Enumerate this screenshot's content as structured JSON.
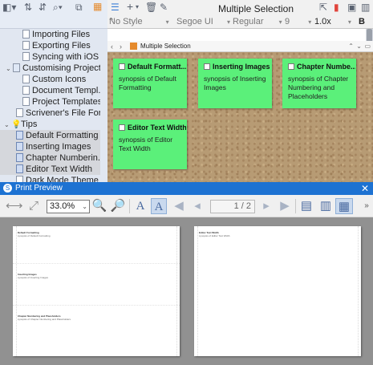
{
  "binder": {
    "items": [
      {
        "label": "Importing Files",
        "icon": "document-icon"
      },
      {
        "label": "Exporting Files",
        "icon": "document-icon"
      },
      {
        "label": "Syncing with iOS",
        "icon": "document-icon"
      },
      {
        "label": "Customising Projects",
        "icon": "folder-icon"
      },
      {
        "label": "Custom Icons",
        "icon": "document-icon"
      },
      {
        "label": "Document Templ...",
        "icon": "document-icon"
      },
      {
        "label": "Project Templates",
        "icon": "document-icon"
      },
      {
        "label": "Scrivener's File For...",
        "icon": "document-icon"
      },
      {
        "label": "Tips",
        "icon": "lightbulb-icon"
      },
      {
        "label": "Default Formatting",
        "icon": "document-icon"
      },
      {
        "label": "Inserting Images",
        "icon": "document-icon"
      },
      {
        "label": "Chapter Numberin...",
        "icon": "document-icon"
      },
      {
        "label": "Editor Text Width",
        "icon": "document-icon"
      },
      {
        "label": "Dark Mode Theme",
        "icon": "document-icon"
      }
    ]
  },
  "editor": {
    "title": "Multiple Selection",
    "style": "No Style",
    "font": "Segoe UI",
    "weight": "Regular",
    "size": "9",
    "zoom": "1.0x",
    "bold": "B",
    "breadcrumb": "Multiple Selection"
  },
  "cards": [
    {
      "title": "Default Formatt...",
      "synopsis": "synopsis of Default Formatting"
    },
    {
      "title": "Inserting Images",
      "synopsis": "synopsis of Inserting Images"
    },
    {
      "title": "Chapter Numbe...",
      "synopsis": "synopsis of Chapter Numbering and Placeholders"
    },
    {
      "title": "Editor Text Width",
      "synopsis": "synopsis of Editor Text Width"
    }
  ],
  "print_preview": {
    "title": "Print Preview",
    "close": "✕",
    "zoom": "33.0%",
    "page_indicator": "1 / 2",
    "page1": [
      {
        "heading": "Default Formatting",
        "synopsis": "synopsis of Default Formatting"
      },
      {
        "heading": "Inserting Images",
        "synopsis": "synopsis of Inserting Images"
      },
      {
        "heading": "Chapter Numbering and Placeholders",
        "synopsis": "synopsis of Chapter Numbering and Placeholders"
      }
    ],
    "page2": [
      {
        "heading": "Editor Text Width",
        "synopsis": "synopsis of Editor Text Width"
      }
    ]
  },
  "colors": {
    "card_green": "#5bf07a",
    "titlebar_blue": "#1d72d2",
    "binder_bg": "#e1e7f1",
    "cork": "#b79b74"
  }
}
